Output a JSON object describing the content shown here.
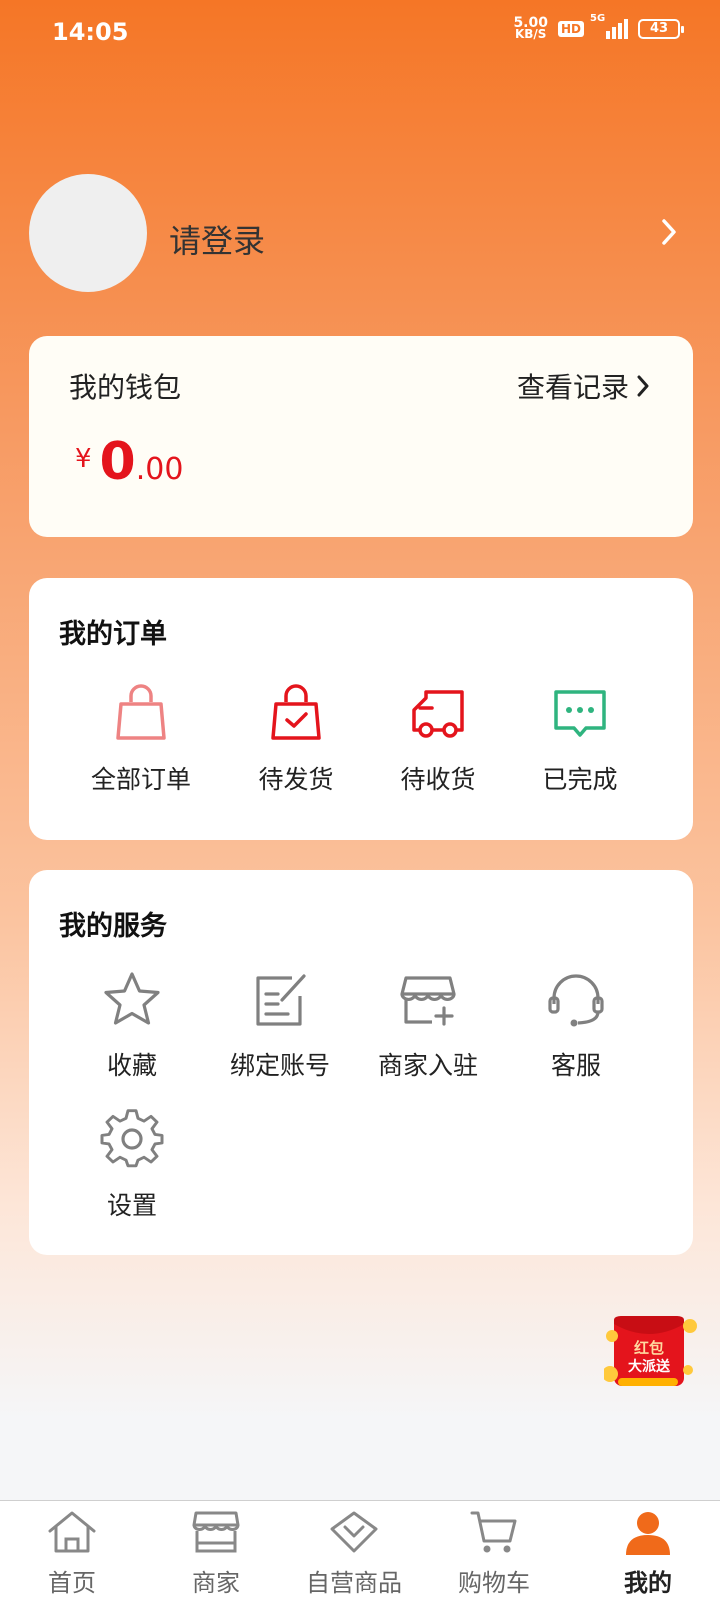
{
  "status_bar": {
    "time": "14:05",
    "net_speed_value": "5.00",
    "net_speed_unit": "KB/S",
    "hd": "HD",
    "network": "5G",
    "battery": "43"
  },
  "profile": {
    "login_text": "请登录"
  },
  "wallet": {
    "title": "我的钱包",
    "records_link": "查看记录",
    "currency": "¥",
    "amount_int": "0",
    "amount_dec": ".00"
  },
  "orders": {
    "title": "我的订单",
    "items": [
      {
        "label": "全部订单",
        "icon": "shopping-bag-icon",
        "color": "#ee8383"
      },
      {
        "label": "待发货",
        "icon": "bag-check-icon",
        "color": "#e4141c"
      },
      {
        "label": "待收货",
        "icon": "delivery-truck-icon",
        "color": "#e4141c"
      },
      {
        "label": "已完成",
        "icon": "chat-bubble-icon",
        "color": "#2fb47f"
      }
    ]
  },
  "services": {
    "title": "我的服务",
    "items": [
      {
        "label": "收藏",
        "icon": "star-icon"
      },
      {
        "label": "绑定账号",
        "icon": "edit-note-icon"
      },
      {
        "label": "商家入驻",
        "icon": "store-add-icon"
      },
      {
        "label": "客服",
        "icon": "headset-icon"
      },
      {
        "label": "设置",
        "icon": "gear-icon"
      }
    ]
  },
  "promo": {
    "text_line1": "红包",
    "text_line2": "大派送"
  },
  "tabbar": {
    "items": [
      {
        "label": "首页",
        "icon": "home-icon",
        "active": false
      },
      {
        "label": "商家",
        "icon": "shop-icon",
        "active": false
      },
      {
        "label": "自营商品",
        "icon": "diamond-icon",
        "active": false
      },
      {
        "label": "购物车",
        "icon": "cart-icon",
        "active": false
      },
      {
        "label": "我的",
        "icon": "user-icon",
        "active": true
      }
    ]
  },
  "colors": {
    "brand_orange": "#f57626",
    "price_red": "#e4141c",
    "icon_gray": "#808080"
  }
}
